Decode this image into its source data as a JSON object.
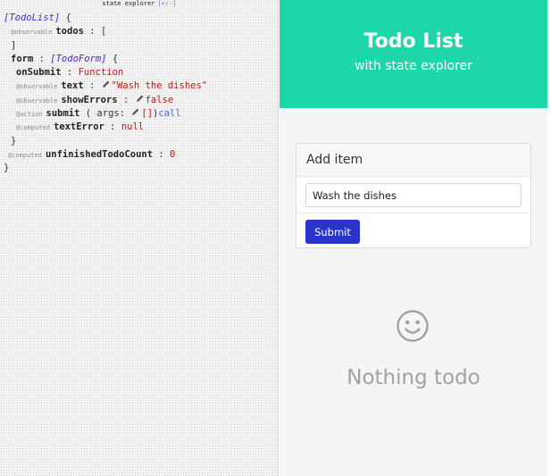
{
  "explorer": {
    "title": "state explorer",
    "toggle": "[+/-]",
    "root_type": "[TodoList]",
    "open_brace": "{",
    "close_brace": "}",
    "annotations": {
      "observable": "@observable",
      "action": "@action",
      "computed": "@computed"
    },
    "todos": {
      "key": "todos",
      "colon": ":",
      "open": "[",
      "close": "]"
    },
    "form": {
      "key": "form",
      "colon": ":",
      "type": "[TodoForm]",
      "open": "{",
      "close": "}",
      "onSubmit": {
        "key": "onSubmit",
        "colon": ":",
        "value": "Function"
      },
      "text": {
        "key": "text",
        "colon": ":",
        "value": "\"Wash the dishes\""
      },
      "showErrors": {
        "key": "showErrors",
        "colon": ":",
        "value": "false"
      },
      "submit": {
        "key": "submit",
        "args_open": "( args:",
        "args_value": "[]",
        "args_close": ")",
        "call": "call"
      },
      "textError": {
        "key": "textError",
        "colon": ":",
        "value": "null"
      }
    },
    "unfinishedTodoCount": {
      "key": "unfinishedTodoCount",
      "colon": ":",
      "value": "0"
    },
    "edit_icon": "pencil-icon"
  },
  "app": {
    "colors": {
      "hero": "#1ed7a8",
      "button": "#2b34c8",
      "empty_text": "#a2a2a2"
    },
    "hero": {
      "title": "Todo List",
      "subtitle": "with state explorer"
    },
    "card": {
      "header": "Add item",
      "input_value": "Wash the dishes",
      "submit_label": "Submit"
    },
    "empty_state": {
      "icon": "smiley-icon",
      "text": "Nothing todo"
    }
  }
}
